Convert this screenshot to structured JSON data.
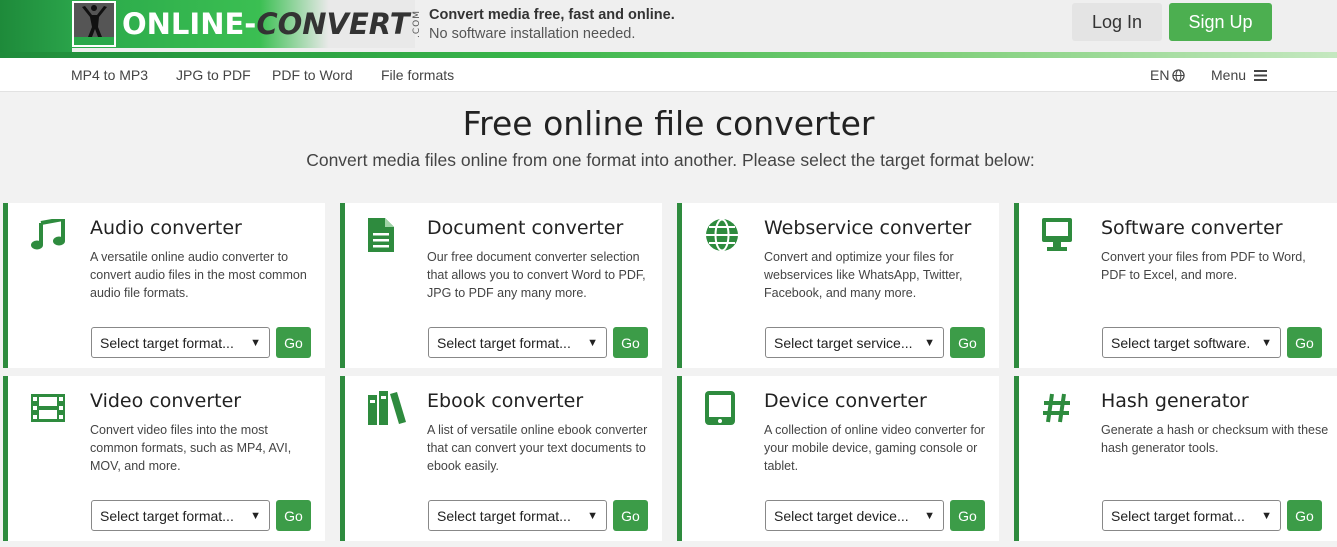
{
  "header": {
    "logo_white": "ONLINE-",
    "logo_dark": "CONVERT",
    "logo_com": ".COM",
    "tagline_1": "Convert media free, fast and online.",
    "tagline_2": "No software installation needed.",
    "login_label": "Log In",
    "signup_label": "Sign Up"
  },
  "nav": {
    "links": [
      "MP4 to MP3",
      "JPG to PDF",
      "PDF to Word",
      "File formats"
    ],
    "lang": "EN",
    "menu": "Menu"
  },
  "hero": {
    "title": "Free online file converter",
    "subtitle": "Convert media files online from one format into another. Please select the target format below:"
  },
  "go_label": "Go",
  "cards": [
    {
      "title": "Audio converter",
      "desc": "A versatile online audio converter to convert audio files in the most common audio file formats.",
      "select": "Select target format...",
      "icon": "music-note-icon"
    },
    {
      "title": "Document converter",
      "desc": "Our free document converter selection that allows you to convert Word to PDF, JPG to PDF any many more.",
      "select": "Select target format...",
      "icon": "document-icon"
    },
    {
      "title": "Webservice converter",
      "desc": "Convert and optimize your files for webservices like WhatsApp, Twitter, Facebook, and many more.",
      "select": "Select target service...",
      "icon": "globe-icon"
    },
    {
      "title": "Software converter",
      "desc": "Convert your files from PDF to Word, PDF to Excel, and more.",
      "select": "Select target software.",
      "icon": "monitor-icon"
    },
    {
      "title": "Video converter",
      "desc": "Convert video files into the most common formats, such as MP4, AVI, MOV, and more.",
      "select": "Select target format...",
      "icon": "film-icon"
    },
    {
      "title": "Ebook converter",
      "desc": "A list of versatile online ebook converter that can convert your text documents to ebook easily.",
      "select": "Select target format...",
      "icon": "books-icon"
    },
    {
      "title": "Device converter",
      "desc": "A collection of online video converter for your mobile device, gaming console or tablet.",
      "select": "Select target device...",
      "icon": "tablet-icon"
    },
    {
      "title": "Hash generator",
      "desc": "Generate a hash or checksum with these hash generator tools.",
      "select": "Select target format...",
      "icon": "hash-icon"
    }
  ],
  "colors": {
    "accent": "#2e8b3e",
    "button": "#3c9c48",
    "signup": "#4caf50"
  }
}
